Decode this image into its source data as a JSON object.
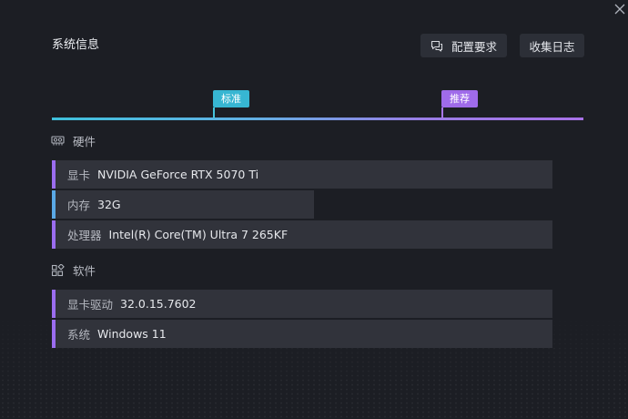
{
  "window": {
    "title": "系统信息",
    "close_icon": "close-icon"
  },
  "header": {
    "config_button": {
      "label": "配置要求",
      "icon": "chat-bubbles-icon"
    },
    "log_button": {
      "label": "收集日志"
    }
  },
  "tiers": {
    "standard_label": "标准",
    "recommended_label": "推荐",
    "colors": {
      "standard": "#37b6d2",
      "recommended": "#9f6bea"
    }
  },
  "hardware": {
    "title": "硬件",
    "icon": "gpu-card-icon",
    "rows": [
      {
        "label": "显卡",
        "value": "NVIDIA GeForce RTX 5070 Ti",
        "status_color": "#9b6df0"
      },
      {
        "label": "内存",
        "value": "32G",
        "status_color": "#5aa9e6"
      },
      {
        "label": "处理器",
        "value": "Intel(R) Core(TM) Ultra 7 265KF",
        "status_color": "#9b6df0"
      }
    ]
  },
  "software": {
    "title": "软件",
    "icon": "apps-grid-icon",
    "rows": [
      {
        "label": "显卡驱动",
        "value": "32.0.15.7602",
        "status_color": "#9b6df0"
      },
      {
        "label": "系统",
        "value": "Windows 11",
        "status_color": "#9b6df0"
      }
    ]
  }
}
